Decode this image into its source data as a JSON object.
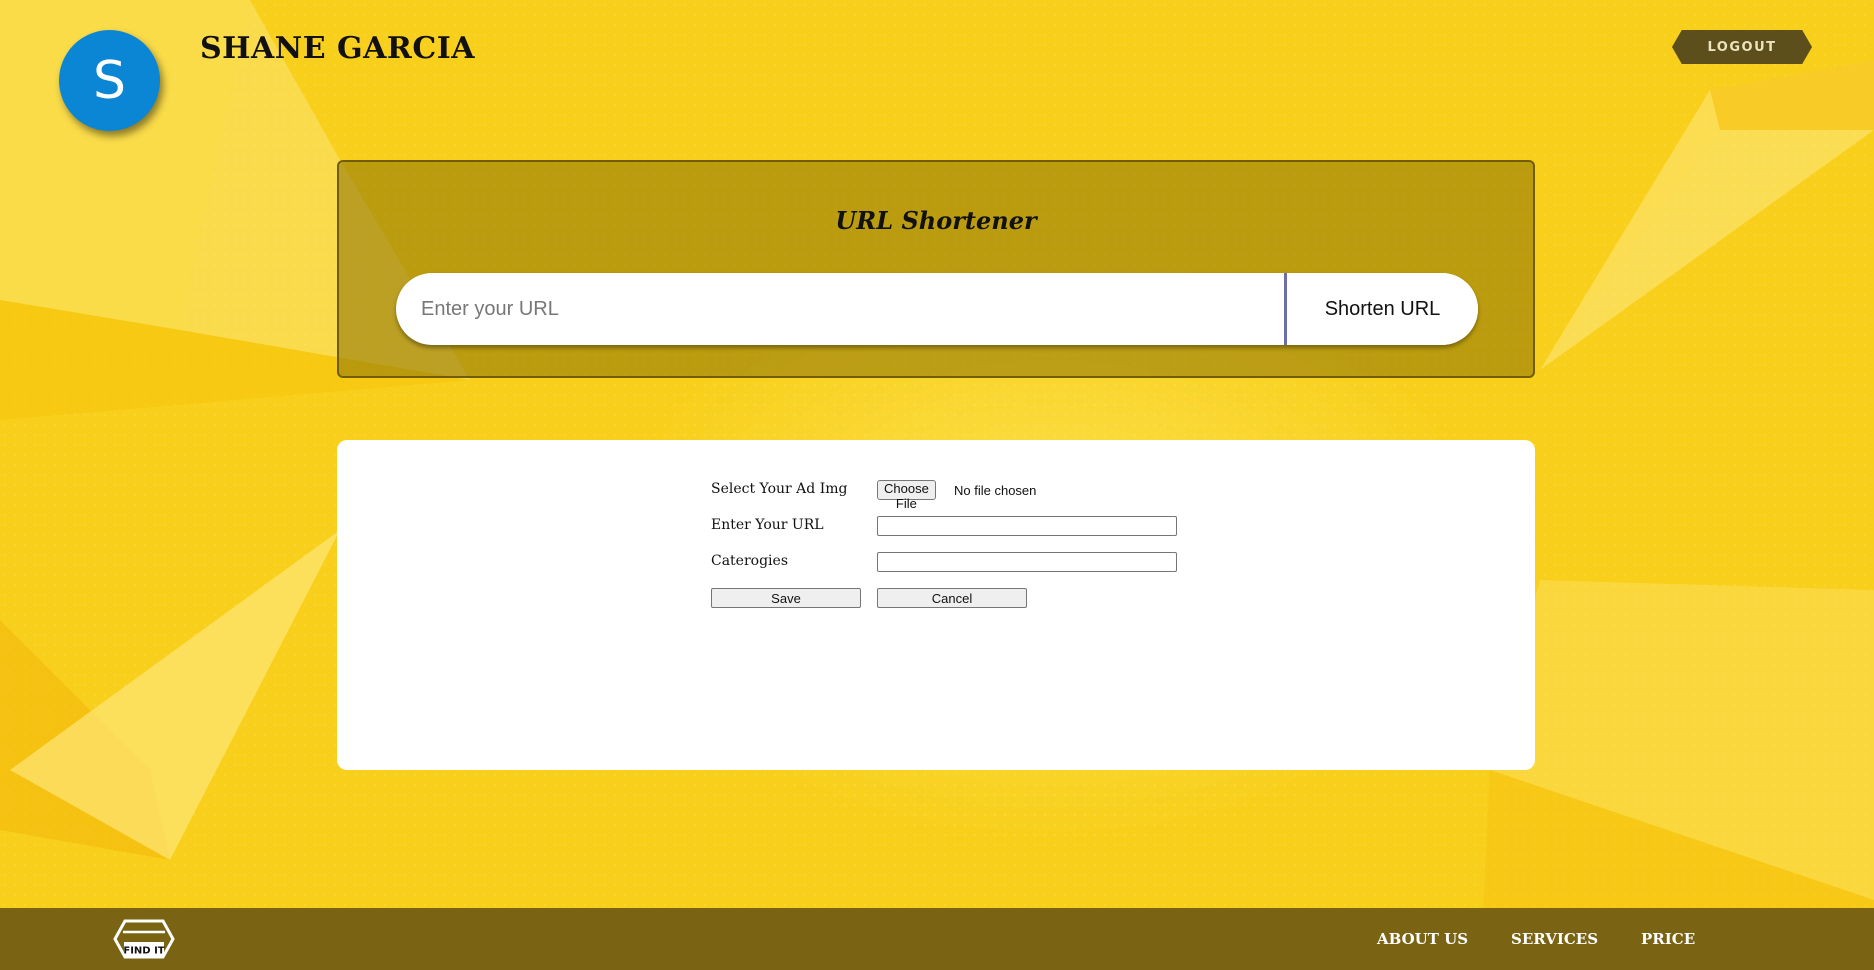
{
  "header": {
    "avatar_letter": "S",
    "user_name": "SHANE GARCIA",
    "logout_label": "LOGOUT"
  },
  "shortener": {
    "title": "URL Shortener",
    "input_placeholder": "Enter your URL",
    "button_label": "Shorten URL"
  },
  "ad_form": {
    "image_label": "Select Your Ad Img",
    "choose_file_label": "Choose File",
    "file_status": "No file chosen",
    "url_label": "Enter Your URL",
    "url_value": "",
    "categories_label": "Caterogies",
    "categories_value": "",
    "save_label": "Save",
    "cancel_label": "Cancel"
  },
  "footer": {
    "logo_text": "FIND IT",
    "nav": [
      "ABOUT US",
      "SERVICES",
      "PRICE"
    ]
  },
  "colors": {
    "background": "#f8cf1a",
    "panel": "#a08a0f",
    "footer": "#7a6414",
    "avatar": "#0b86d4",
    "logout": "#5c4f1c"
  },
  "icons": [
    "user-avatar-icon",
    "find-it-logo-icon"
  ]
}
